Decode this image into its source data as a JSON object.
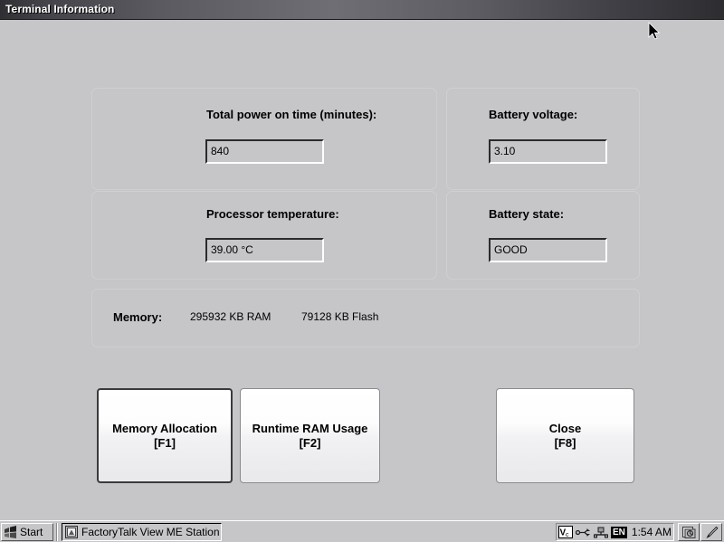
{
  "window": {
    "title": "Terminal Information"
  },
  "fields": {
    "power_on_time": {
      "label": "Total power on time (minutes):",
      "value": "840"
    },
    "battery_voltage": {
      "label": "Battery voltage:",
      "value": "3.10"
    },
    "processor_temperature": {
      "label": "Processor temperature:",
      "value": "39.00 °C"
    },
    "battery_state": {
      "label": "Battery state:",
      "value": "GOOD"
    }
  },
  "memory": {
    "label": "Memory:",
    "ram": "295932 KB RAM",
    "flash": "79128 KB Flash"
  },
  "buttons": {
    "memory_allocation": {
      "title": "Memory Allocation",
      "shortcut": "[F1]"
    },
    "runtime_ram_usage": {
      "title": "Runtime RAM Usage",
      "shortcut": "[F2]"
    },
    "close": {
      "title": "Close",
      "shortcut": "[F8]"
    }
  },
  "taskbar": {
    "start_label": "Start",
    "start_icon": "windows-flag-icon",
    "task_item_label": "FactoryTalk View ME Station",
    "task_item_icon": "application-window-icon",
    "tray": {
      "icons": [
        "vnc-server-icon",
        "usb-connection-icon",
        "network-connection-icon"
      ],
      "language": "EN",
      "clock": "1:54 AM"
    },
    "buttons": [
      {
        "icon": "show-desktop-icon"
      },
      {
        "icon": "stylus-pen-icon"
      }
    ]
  },
  "colors": {
    "desktop_background": "#c6c6c9",
    "titlebar_dark": "#2d2d31",
    "titlebar_light": "#6e6e74",
    "field_border_dark": "#2b2b2b",
    "field_border_light": "#ffffff",
    "button_face_top": "#ffffff",
    "button_face_bottom": "#e9e9ec",
    "focus_border": "#3a3a3d"
  },
  "cursor": {
    "icon": "mouse-pointer-arrow"
  }
}
